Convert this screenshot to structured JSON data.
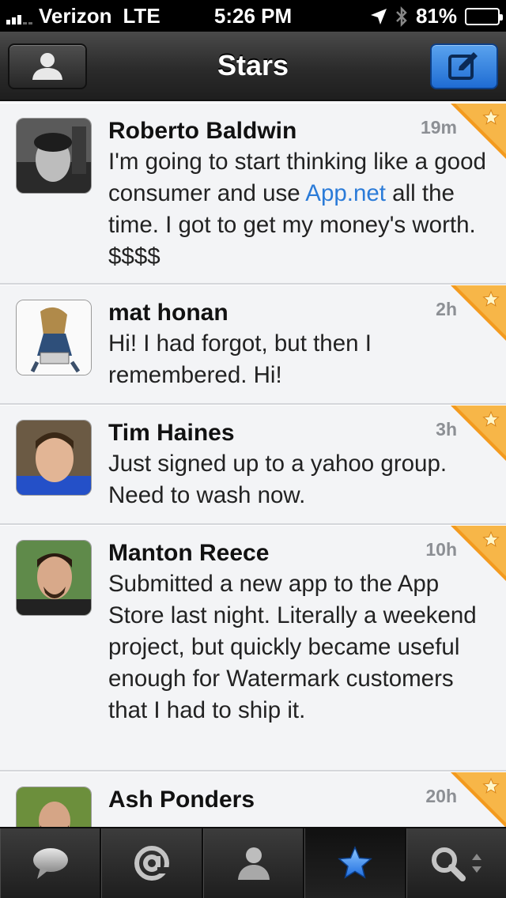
{
  "status": {
    "carrier": "Verizon",
    "network": "LTE",
    "time": "5:26 PM",
    "battery": "81%",
    "battery_level": 0.81
  },
  "nav": {
    "title": "Stars",
    "left_icon": "profile-icon",
    "right_icon": "compose-icon",
    "accent": "#2f7fe0"
  },
  "posts": [
    {
      "name": "Roberto Baldwin",
      "time": "19m",
      "text_before": "I'm going to start thinking like a good consumer and use ",
      "link": "App.net",
      "text_after": " all the time. I got to get my money's worth. $$$$",
      "starred": true
    },
    {
      "name": "mat honan",
      "time": "2h",
      "text": "Hi! I had forgot, but then I remembered. Hi!",
      "starred": true
    },
    {
      "name": "Tim Haines",
      "time": "3h",
      "text": "Just signed up to a yahoo group. Need to wash now.",
      "starred": true
    },
    {
      "name": "Manton Reece",
      "time": "10h",
      "text": "Submitted a new app to the App Store last night. Literally a weekend project, but quickly became useful enough for Watermark customers that I had to ship it.",
      "starred": true
    },
    {
      "name": "Ash Ponders",
      "time": "20h",
      "starred": true
    }
  ],
  "tabs": [
    {
      "icon": "speech-bubble-icon",
      "active": false
    },
    {
      "icon": "at-sign-icon",
      "active": false
    },
    {
      "icon": "user-icon",
      "active": false
    },
    {
      "icon": "star-icon",
      "active": true
    },
    {
      "icon": "search-icon",
      "active": false
    }
  ]
}
